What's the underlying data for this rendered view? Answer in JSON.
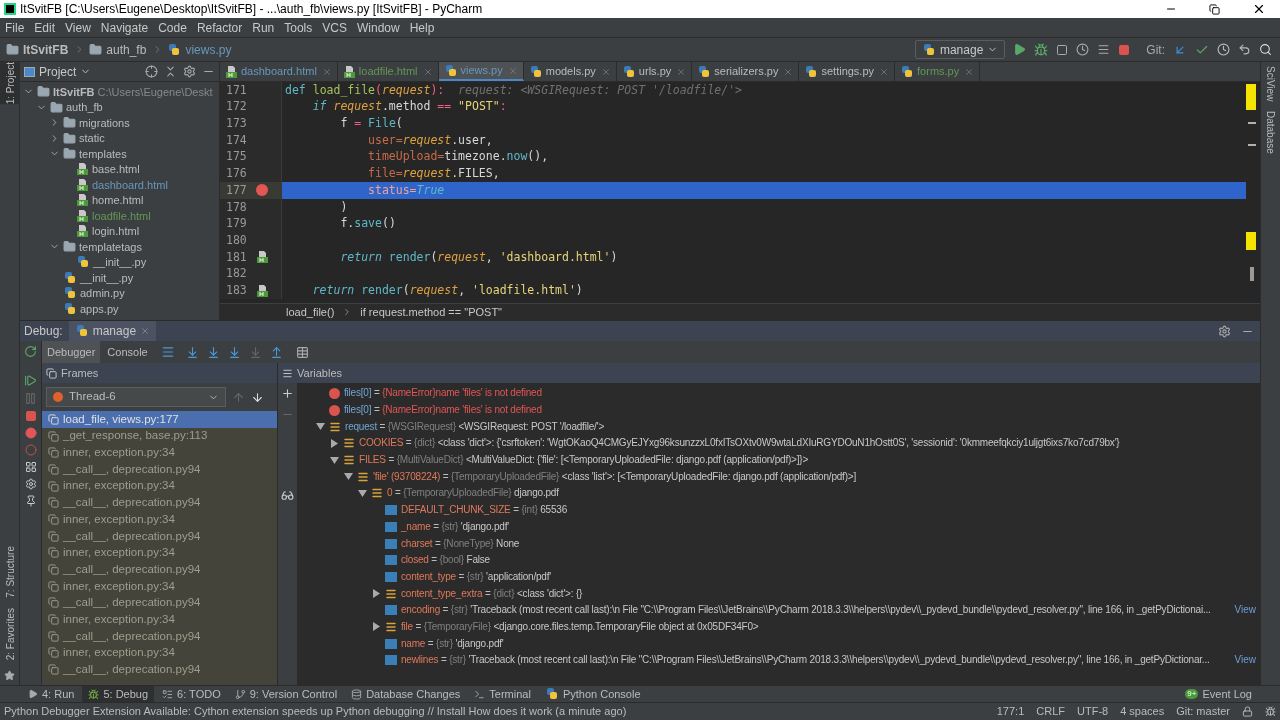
{
  "window": {
    "title": "ItSvitFB [C:\\Users\\Eugene\\Desktop\\ItSvitFB] - ...\\auth_fb\\views.py [ItSvitFB] - PyCharm"
  },
  "menu": [
    "File",
    "Edit",
    "View",
    "Navigate",
    "Code",
    "Refactor",
    "Run",
    "Tools",
    "VCS",
    "Window",
    "Help"
  ],
  "nav_bar": {
    "breadcrumb": [
      {
        "kind": "project",
        "label": "ItSvitFB"
      },
      {
        "kind": "folder",
        "label": "auth_fb"
      },
      {
        "kind": "python",
        "label": "views.py"
      }
    ],
    "run_config": "manage",
    "git_label": "Git:"
  },
  "left_stripe": {
    "top": [
      {
        "label": "1: Project",
        "selected": true
      }
    ],
    "bottom": [
      {
        "label": "7: Structure",
        "selected": false
      },
      {
        "label": "2: Favorites",
        "selected": false
      }
    ]
  },
  "right_stripe": [
    "SciView",
    "Database"
  ],
  "project": {
    "title": "Project",
    "tree": [
      {
        "kind": "project",
        "label": "ItSvitFB",
        "path": "C:\\Users\\Eugene\\Deskt",
        "expanded": true,
        "children": [
          {
            "kind": "folder",
            "label": "auth_fb",
            "expanded": true,
            "children": [
              {
                "kind": "folder",
                "label": "migrations",
                "expanded": false
              },
              {
                "kind": "folder",
                "label": "static",
                "expanded": false
              },
              {
                "kind": "folder",
                "label": "templates",
                "expanded": true,
                "children": [
                  {
                    "kind": "html",
                    "label": "base.html",
                    "color": "#bbbbbb"
                  },
                  {
                    "kind": "html",
                    "label": "dashboard.html",
                    "color": "#6897bb"
                  },
                  {
                    "kind": "html",
                    "label": "home.html",
                    "color": "#bbbbbb"
                  },
                  {
                    "kind": "html",
                    "label": "loadfile.html",
                    "color": "#629755"
                  },
                  {
                    "kind": "html",
                    "label": "login.html",
                    "color": "#bbbbbb"
                  }
                ]
              },
              {
                "kind": "folder",
                "label": "templatetags",
                "expanded": true,
                "children": [
                  {
                    "kind": "python",
                    "label": "__init__.py",
                    "color": "#bbbbbb"
                  }
                ]
              },
              {
                "kind": "python",
                "label": "__init__.py",
                "color": "#bbbbbb"
              },
              {
                "kind": "python",
                "label": "admin.py",
                "color": "#bbbbbb"
              },
              {
                "kind": "python",
                "label": "apps.py",
                "color": "#bbbbbb"
              }
            ]
          }
        ]
      }
    ]
  },
  "editor": {
    "tabs": [
      {
        "kind": "html",
        "label": "dashboard.html",
        "color": "#6897bb",
        "selected": false
      },
      {
        "kind": "html",
        "label": "loadfile.html",
        "color": "#629755",
        "selected": false
      },
      {
        "kind": "python",
        "label": "views.py",
        "color": "#6897bb",
        "selected": true
      },
      {
        "kind": "python",
        "label": "models.py",
        "color": "#bbbbbb",
        "selected": false
      },
      {
        "kind": "python",
        "label": "urls.py",
        "color": "#bbbbbb",
        "selected": false
      },
      {
        "kind": "python",
        "label": "serializers.py",
        "color": "#bbbbbb",
        "selected": false
      },
      {
        "kind": "python",
        "label": "settings.py",
        "color": "#bbbbbb",
        "selected": false
      },
      {
        "kind": "python",
        "label": "forms.py",
        "color": "#629755",
        "selected": false
      }
    ],
    "lines": [
      {
        "number": "171",
        "current": false,
        "breakpoint": false,
        "template_link": false,
        "tokens": [
          {
            "kind": "def",
            "text": "def "
          },
          {
            "kind": "func",
            "text": "load_file"
          },
          {
            "kind": "op",
            "text": "("
          },
          {
            "kind": "param",
            "text": "request"
          },
          {
            "kind": "op",
            "text": "):"
          },
          {
            "kind": "hint",
            "text": "  request: <WSGIRequest: POST '/loadfile/'>"
          }
        ]
      },
      {
        "number": "172",
        "current": false,
        "breakpoint": false,
        "template_link": false,
        "tokens": [
          {
            "kind": "keyword",
            "text": "    if "
          },
          {
            "kind": "param",
            "text": "request"
          },
          {
            "kind": "plain",
            "text": ".method "
          },
          {
            "kind": "op",
            "text": "== "
          },
          {
            "kind": "string",
            "text": "\"POST\""
          },
          {
            "kind": "op",
            "text": ":"
          }
        ]
      },
      {
        "number": "173",
        "current": false,
        "breakpoint": false,
        "template_link": false,
        "tokens": [
          {
            "kind": "plain",
            "text": "        f "
          },
          {
            "kind": "op",
            "text": "= "
          },
          {
            "kind": "call",
            "text": "File"
          },
          {
            "kind": "plain",
            "text": "("
          }
        ]
      },
      {
        "number": "174",
        "current": false,
        "breakpoint": false,
        "template_link": false,
        "tokens": [
          {
            "kind": "named",
            "text": "            user="
          },
          {
            "kind": "param",
            "text": "request"
          },
          {
            "kind": "plain",
            "text": ".user,"
          }
        ]
      },
      {
        "number": "175",
        "current": false,
        "breakpoint": false,
        "template_link": false,
        "tokens": [
          {
            "kind": "named",
            "text": "            timeUpload="
          },
          {
            "kind": "plain",
            "text": "timezone."
          },
          {
            "kind": "call",
            "text": "now"
          },
          {
            "kind": "plain",
            "text": "(),"
          }
        ]
      },
      {
        "number": "176",
        "current": false,
        "breakpoint": false,
        "template_link": false,
        "tokens": [
          {
            "kind": "named",
            "text": "            file="
          },
          {
            "kind": "param",
            "text": "request"
          },
          {
            "kind": "plain",
            "text": ".FILES,"
          }
        ]
      },
      {
        "number": "177",
        "current": true,
        "breakpoint": true,
        "template_link": false,
        "tokens": [
          {
            "kind": "named",
            "text": "            status="
          },
          {
            "kind": "const",
            "text": "True"
          }
        ]
      },
      {
        "number": "178",
        "current": false,
        "breakpoint": false,
        "template_link": false,
        "tokens": [
          {
            "kind": "plain",
            "text": "        )"
          }
        ]
      },
      {
        "number": "179",
        "current": false,
        "breakpoint": false,
        "template_link": false,
        "tokens": [
          {
            "kind": "plain",
            "text": "        f."
          },
          {
            "kind": "call",
            "text": "save"
          },
          {
            "kind": "plain",
            "text": "()"
          }
        ]
      },
      {
        "number": "180",
        "current": false,
        "breakpoint": false,
        "template_link": false
      },
      {
        "number": "181",
        "current": false,
        "breakpoint": false,
        "template_link": true,
        "tokens": [
          {
            "kind": "keyword",
            "text": "        return "
          },
          {
            "kind": "call",
            "text": "render"
          },
          {
            "kind": "plain",
            "text": "("
          },
          {
            "kind": "param",
            "text": "request"
          },
          {
            "kind": "plain",
            "text": ", "
          },
          {
            "kind": "string",
            "text": "'dashboard.html'"
          },
          {
            "kind": "plain",
            "text": ")"
          }
        ]
      },
      {
        "number": "182",
        "current": false,
        "breakpoint": false,
        "template_link": false
      },
      {
        "number": "183",
        "current": false,
        "breakpoint": false,
        "template_link": true,
        "tokens": [
          {
            "kind": "keyword",
            "text": "    return "
          },
          {
            "kind": "call",
            "text": "render"
          },
          {
            "kind": "plain",
            "text": "("
          },
          {
            "kind": "param",
            "text": "request"
          },
          {
            "kind": "plain",
            "text": ", "
          },
          {
            "kind": "string",
            "text": "'loadfile.html'"
          },
          {
            "kind": "plain",
            "text": ")"
          }
        ]
      }
    ],
    "breadcrumb": [
      "load_file()",
      "if request.method == \"POST\""
    ]
  },
  "debug": {
    "label": "Debug:",
    "session": "manage",
    "tabs": [
      {
        "label": "Debugger",
        "selected": true
      },
      {
        "label": "Console",
        "selected": false
      }
    ],
    "frames_title": "Frames",
    "thread": "Thread-6",
    "frames": [
      {
        "label": "load_file, views.py:177",
        "selected": true
      },
      {
        "label": "_get_response, base.py:113",
        "selected": false
      },
      {
        "label": "inner, exception.py:34",
        "selected": false
      },
      {
        "label": "__call__, deprecation.py94",
        "selected": false
      },
      {
        "label": "inner, exception.py:34",
        "selected": false
      },
      {
        "label": "__call__, deprecation.py94",
        "selected": false
      },
      {
        "label": "inner, exception.py:34",
        "selected": false
      },
      {
        "label": "__call__, deprecation.py94",
        "selected": false
      },
      {
        "label": "inner, exception.py:34",
        "selected": false
      },
      {
        "label": "__call__, deprecation.py94",
        "selected": false
      },
      {
        "label": "inner, exception.py:34",
        "selected": false
      },
      {
        "label": "__call__, deprecation.py94",
        "selected": false
      },
      {
        "label": "inner, exception.py:34",
        "selected": false
      },
      {
        "label": "__call__, deprecation.py94",
        "selected": false
      },
      {
        "label": "inner, exception.py:34",
        "selected": false
      },
      {
        "label": "__call__, deprecation.py94",
        "selected": false
      }
    ],
    "variables_title": "Variables",
    "variables": [
      {
        "kind": "error",
        "name": "files[0]",
        "sep": "=",
        "value": "{NameError}name 'files' is not defined"
      },
      {
        "kind": "error",
        "name": "files[0]",
        "sep": "=",
        "value": "{NameError}name 'files' is not defined"
      },
      {
        "kind": "object",
        "name": "request",
        "sep": "=",
        "type": "{WSGIRequest}",
        "value": "<WSGIRequest: POST '/loadfile/'>",
        "expanded": true,
        "children": [
          {
            "kind": "object",
            "name": "COOKIES",
            "sep": "=",
            "type": "{dict}",
            "value": "<class 'dict'>: {'csrftoken': 'WgtOKaoQ4CMGyEJYxg96ksunzzxL0fxITsOXtv0W9wtaLdXIuRGYDOuN1hOstt0S', 'sessionid': '0kmmeefqkciy1uljgt6ixs7ko7cd79bx'}",
            "expanded": false
          },
          {
            "kind": "object",
            "name": "FILES",
            "sep": "=",
            "type": "{MultiValueDict}",
            "value": "<MultiValueDict: {'file': [<TemporaryUploadedFile: django.pdf (application/pdf)>]}>",
            "expanded": true,
            "children": [
              {
                "kind": "object",
                "name": "'file' (93708224)",
                "sep": "=",
                "type": "{TemporaryUploadedFile}",
                "value": "<class 'list'>: [<TemporaryUploadedFile: django.pdf (application/pdf)>]",
                "expanded": true,
                "children": [
                  {
                    "kind": "object",
                    "name": "0",
                    "sep": "=",
                    "type": "{TemporaryUploadedFile}",
                    "value": "django.pdf",
                    "expanded": true,
                    "children": [
                      {
                        "kind": "value",
                        "name": "DEFAULT_CHUNK_SIZE",
                        "sep": "=",
                        "type": "{int}",
                        "value": "65536"
                      },
                      {
                        "kind": "value",
                        "name": "_name",
                        "sep": "=",
                        "type": "{str}",
                        "value": "'django.pdf'"
                      },
                      {
                        "kind": "value",
                        "name": "charset",
                        "sep": "=",
                        "type": "{NoneType}",
                        "value": "None"
                      },
                      {
                        "kind": "value",
                        "name": "closed",
                        "sep": "=",
                        "type": "{bool}",
                        "value": "False"
                      },
                      {
                        "kind": "value",
                        "name": "content_type",
                        "sep": "=",
                        "type": "{str}",
                        "value": "'application/pdf'"
                      },
                      {
                        "kind": "object",
                        "name": "content_type_extra",
                        "sep": "=",
                        "type": "{dict}",
                        "value": "<class 'dict'>: {}",
                        "expanded": false
                      },
                      {
                        "kind": "value",
                        "name": "encoding",
                        "sep": "=",
                        "type": "{str}",
                        "value": "'Traceback (most recent call last):\\n  File \"C:\\\\Program Files\\\\JetBrains\\\\PyCharm 2018.3.3\\\\helpers\\\\pydev\\\\_pydevd_bundle\\\\pydevd_resolver.py\", line 166, in _getPyDictionai...",
                        "link": "View"
                      },
                      {
                        "kind": "object",
                        "name": "file",
                        "sep": "=",
                        "type": "{TemporaryFile}",
                        "value": "<django.core.files.temp.TemporaryFile object at 0x05DF34F0>",
                        "expanded": false
                      },
                      {
                        "kind": "value",
                        "name": "name",
                        "sep": "=",
                        "type": "{str}",
                        "value": "'django.pdf'"
                      },
                      {
                        "kind": "value",
                        "name": "newlines",
                        "sep": "=",
                        "type": "{str}",
                        "value": "'Traceback (most recent call last):\\n  File \"C:\\\\Program Files\\\\JetBrains\\\\PyCharm 2018.3.3\\\\helpers\\\\pydev\\\\_pydevd_bundle\\\\pydevd_resolver.py\", line 166, in _getPyDictionar...",
                        "link": "View"
                      }
                    ]
                  }
                ]
              }
            ]
          }
        ]
      }
    ]
  },
  "tool_windows": [
    {
      "label": "4: Run",
      "kind": "run",
      "selected": false
    },
    {
      "label": "5: Debug",
      "kind": "debug",
      "selected": true
    },
    {
      "label": "6: TODO",
      "kind": "todo",
      "selected": false
    },
    {
      "label": "9: Version Control",
      "kind": "vcs",
      "selected": false
    },
    {
      "label": "Database Changes",
      "kind": "database",
      "selected": false
    },
    {
      "label": "Terminal",
      "kind": "terminal",
      "selected": false
    },
    {
      "label": "Python Console",
      "kind": "python",
      "selected": false
    }
  ],
  "event_log": {
    "label": "Event Log",
    "badge": "9+"
  },
  "status_bar": {
    "message": "Python Debugger Extension Available: Cython extension speeds up Python debugging // Install How does it work (a minute ago)",
    "items": [
      "177:1",
      "CRLF",
      "UTF-8",
      "4 spaces",
      "Git: master"
    ]
  }
}
